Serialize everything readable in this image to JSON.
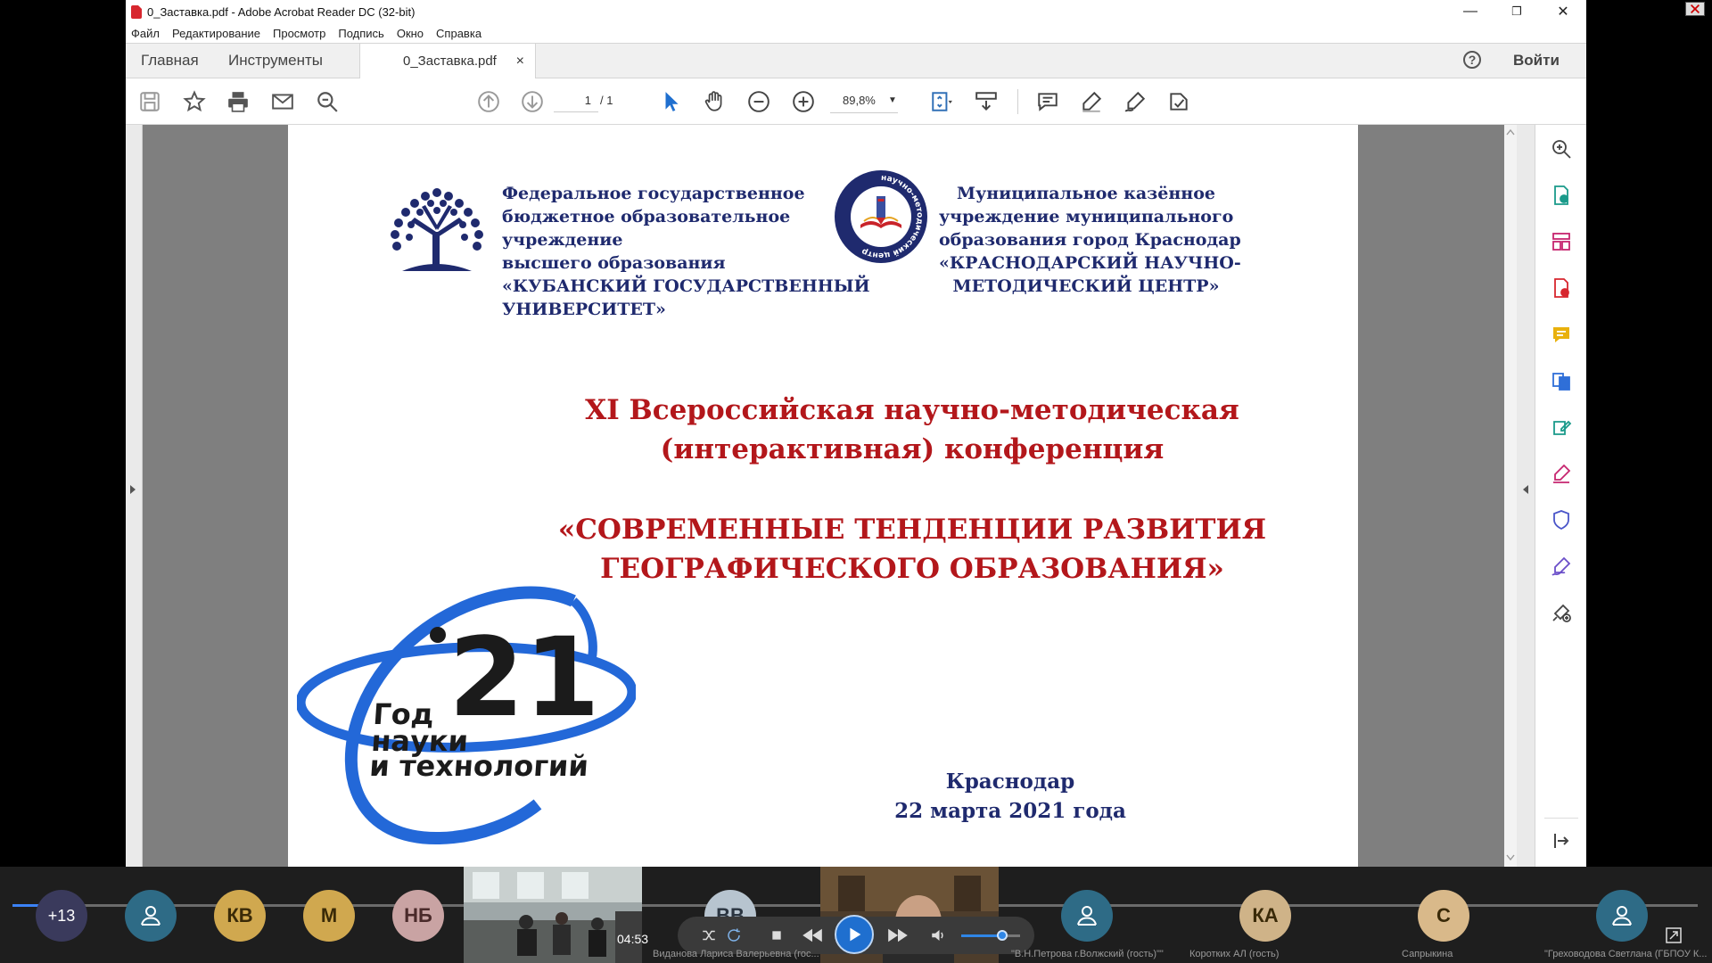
{
  "window": {
    "title": "0_Заставка.pdf - Adobe Acrobat Reader DC (32-bit)",
    "minimize": "—",
    "restore": "❐",
    "close": "✕"
  },
  "menu": [
    "Файл",
    "Редактирование",
    "Просмотр",
    "Подпись",
    "Окно",
    "Справка"
  ],
  "tabs": {
    "home": "Главная",
    "tools": "Инструменты",
    "document": "0_Заставка.pdf",
    "close": "×",
    "help": "?",
    "signin": "Войти"
  },
  "toolbar": {
    "page_current": "1",
    "page_total": "/ 1",
    "zoom": "89,8%",
    "zoom_dropdown": "▼"
  },
  "document": {
    "kubsu": [
      "Федеральное государственное",
      "бюджетное образовательное",
      "учреждение",
      "высшего образования",
      "«КУБАНСКИЙ ГОСУДАРСТВЕННЫЙ",
      "УНИВЕРСИТЕТ»"
    ],
    "knmc": [
      "Муниципальное казённое",
      "учреждение муниципального",
      "образования город Краснодар",
      "«КРАСНОДАРСКИЙ НАУЧНО-",
      "МЕТОДИЧЕСКИЙ ЦЕНТР»"
    ],
    "knmc_ring_text": "научно-методический центр",
    "conference_title": [
      "XI Всероссийская научно-методическая",
      "(интерактивная) конференция"
    ],
    "conference_name": [
      "«СОВРЕМЕННЫЕ ТЕНДЕНЦИИ РАЗВИТИЯ",
      "ГЕОГРАФИЧЕСКОГО ОБРАЗОВАНИЯ»"
    ],
    "year_logo": {
      "number": "21",
      "line1": "Год",
      "line2": "науки",
      "line3": "и технологий"
    },
    "city": "Краснодар",
    "date": "22 марта 2021 года"
  },
  "conference": {
    "more_participants": "+13",
    "participants": [
      {
        "initials": "КВ"
      },
      {
        "initials": "М"
      },
      {
        "initials": "НБ"
      },
      {
        "initials": "ВВ",
        "name": "Виданова Лариса Валерьевна (гос..."
      },
      {
        "name": "\"В.Н.Петрова г.Волжский (гость)\"\""
      },
      {
        "initials": "КА",
        "name": "Коротких АЛ (гость)"
      },
      {
        "initials": "С",
        "name": "Сапрыкина"
      },
      {
        "name": "\"Греховодова Светлана (ГБПОУ К..."
      }
    ],
    "timecode": "04:53",
    "progress_fraction": 0.02,
    "volume_fraction": 0.7
  },
  "colors": {
    "title_red": "#b3171b",
    "text_navy": "#1f2a6e",
    "accent_blue": "#1f6fcf"
  }
}
